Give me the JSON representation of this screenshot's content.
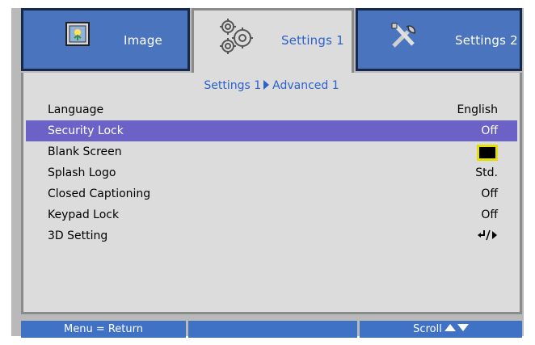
{
  "tabs": [
    {
      "label": "Image",
      "icon": "image-icon",
      "active": false
    },
    {
      "label": "Settings 1",
      "icon": "gears-icon",
      "active": true
    },
    {
      "label": "Settings 2",
      "icon": "tools-icon",
      "active": false
    }
  ],
  "breadcrumb": {
    "part1": "Settings 1",
    "part2": "Advanced 1"
  },
  "rows": [
    {
      "label": "Language",
      "value": "English"
    },
    {
      "label": "Security Lock",
      "value": "Off",
      "selected": true
    },
    {
      "label": "Blank Screen",
      "value": "",
      "swatch_color": "#000000",
      "swatch_border": "#e3e000"
    },
    {
      "label": "Splash Logo",
      "value": "Std."
    },
    {
      "label": "Closed Captioning",
      "value": "Off"
    },
    {
      "label": "Keypad Lock",
      "value": "Off"
    },
    {
      "label": "3D Setting",
      "value": "",
      "value_icon": "enter-right-icon"
    }
  ],
  "bottom_bar": {
    "menu": "Menu = Return",
    "middle": "",
    "scroll": "Scroll"
  },
  "colors": {
    "tab_blue": "#4a74bd",
    "panel_gray": "#dcdcdc",
    "highlight": "#6b61c7",
    "accent_text": "#2b61c9",
    "bar_blue": "#3f72c4"
  }
}
